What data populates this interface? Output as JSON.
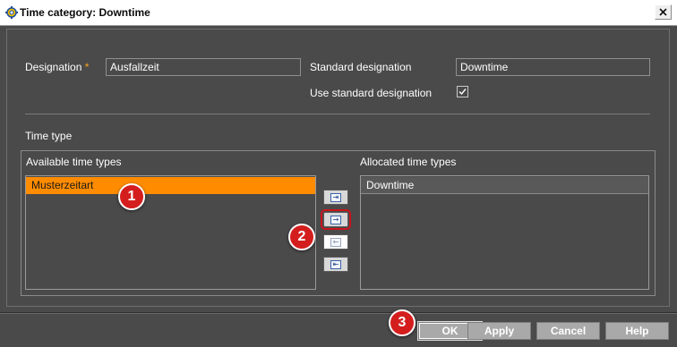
{
  "window": {
    "title": "Time category: Downtime",
    "app_icon": "gear-icon",
    "close_glyph": "✕"
  },
  "form": {
    "designation_label": "Designation",
    "required_marker": "*",
    "designation_value": "Ausfallzeit",
    "standard_designation_label": "Standard designation",
    "standard_designation_value": "Downtime",
    "use_standard_label": "Use standard designation",
    "use_standard_checked": true,
    "checkbox_glyph": "✓"
  },
  "time_type": {
    "section_label": "Time type",
    "available_label": "Available time types",
    "allocated_label": "Allocated time types",
    "available_items": [
      "Musterzeitart"
    ],
    "allocated_items": [
      "Downtime"
    ],
    "move_buttons": {
      "add_all_glyph": "⇥",
      "add_selected_glyph": "→",
      "remove_selected_glyph": "←",
      "remove_all_glyph": "⇤"
    }
  },
  "buttons": {
    "ok": "OK",
    "apply": "Apply",
    "cancel": "Cancel",
    "help": "Help"
  },
  "steps": {
    "step1": "1",
    "step2": "2",
    "step3": "3"
  },
  "colors": {
    "background": "#4b4a4a",
    "selection": "#ff8c00",
    "badge": "#d41e1e",
    "button": "#a9a9a9"
  }
}
